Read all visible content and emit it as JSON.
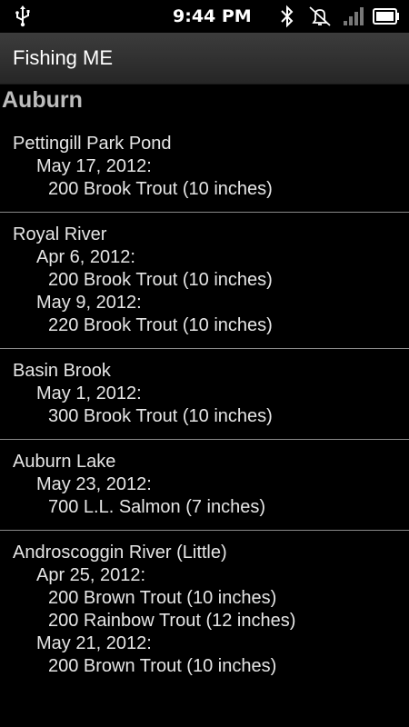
{
  "status_bar": {
    "time": "9:44 PM"
  },
  "app": {
    "title": "Fishing ME"
  },
  "city": "Auburn",
  "locations": [
    {
      "name": "Pettingill Park Pond",
      "stockings": [
        {
          "date": "May 17, 2012:",
          "fish": [
            "200 Brook Trout (10 inches)"
          ]
        }
      ]
    },
    {
      "name": "Royal River",
      "stockings": [
        {
          "date": "Apr 6, 2012:",
          "fish": [
            "200 Brook Trout (10 inches)"
          ]
        },
        {
          "date": "May 9, 2012:",
          "fish": [
            "220 Brook Trout (10 inches)"
          ]
        }
      ]
    },
    {
      "name": "Basin Brook",
      "stockings": [
        {
          "date": "May 1, 2012:",
          "fish": [
            "300 Brook Trout (10 inches)"
          ]
        }
      ]
    },
    {
      "name": "Auburn Lake",
      "stockings": [
        {
          "date": "May 23, 2012:",
          "fish": [
            "700 L.L. Salmon (7 inches)"
          ]
        }
      ]
    },
    {
      "name": "Androscoggin River (Little)",
      "stockings": [
        {
          "date": "Apr 25, 2012:",
          "fish": [
            "200 Brown Trout (10 inches)",
            "200 Rainbow Trout (12 inches)"
          ]
        },
        {
          "date": "May 21, 2012:",
          "fish": [
            "200 Brown Trout (10 inches)"
          ]
        }
      ]
    }
  ],
  "icons": {
    "usb": "usb-icon",
    "bluetooth": "bluetooth-icon",
    "alarm_off": "alarm-off-icon",
    "signal": "signal-icon",
    "battery": "battery-icon"
  }
}
